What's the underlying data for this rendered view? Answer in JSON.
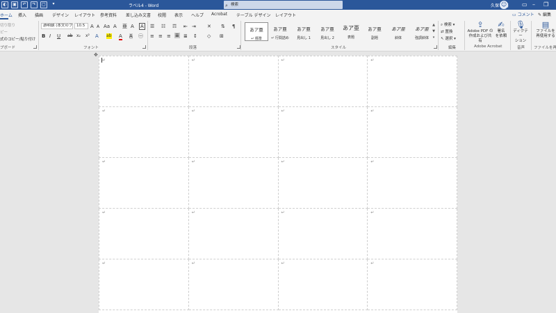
{
  "titlebar": {
    "doc_title": "ラベル4 - Word",
    "search_placeholder": "検索",
    "user_name": "久保 昌裕",
    "qat_icons": [
      "autosave-icon",
      "save-icon",
      "undo-icon",
      "redo-icon",
      "new-doc-icon",
      "customize-qat-icon"
    ]
  },
  "tabs": [
    {
      "label": "ホーム",
      "active": true
    },
    {
      "label": "挿入"
    },
    {
      "label": "描画"
    },
    {
      "label": "デザイン"
    },
    {
      "label": "レイアウト"
    },
    {
      "label": "参考資料"
    },
    {
      "label": "差し込み文書"
    },
    {
      "label": "校閲"
    },
    {
      "label": "表示"
    },
    {
      "label": "ヘルプ"
    },
    {
      "label": "Acrobat"
    },
    {
      "label": "テーブル デザイン"
    },
    {
      "label": "レイアウト"
    }
  ],
  "share_label": "コメント",
  "edit_label": "編集",
  "ribbon": {
    "clipboard": {
      "label": "プボード",
      "items": [
        "切り取り",
        "ピー",
        "式のコピー/貼り付け"
      ]
    },
    "font": {
      "label": "フォント",
      "font_name": "游明朝 (本文のフ",
      "font_size": "10.5",
      "grow": "A",
      "shrink": "A",
      "case": "Aa",
      "clear": "A",
      "phonetic": "亜",
      "enclose": "A",
      "bold": "B",
      "italic": "I",
      "underline": "U",
      "strike": "ab",
      "subscript": "x₂",
      "superscript": "x²",
      "effects": "A",
      "highlight": "ab",
      "color": "A",
      "shade": "A",
      "border_char": "A"
    },
    "paragraph": {
      "label": "段落"
    },
    "styles": {
      "label": "スタイル",
      "items": [
        {
          "preview": "あア亜",
          "name": "↵ 標準"
        },
        {
          "preview": "あア亜",
          "name": "↵ 行間詰め"
        },
        {
          "preview": "あア亜",
          "name": "見出し 1"
        },
        {
          "preview": "あア亜",
          "name": "見出し 2"
        },
        {
          "preview": "あア亜",
          "name": "表題"
        },
        {
          "preview": "あア亜",
          "name": "副題"
        },
        {
          "preview": "あア亜",
          "name": "斜体"
        },
        {
          "preview": "あア亜",
          "name": "強調斜体"
        }
      ]
    },
    "editing": {
      "label": "編集",
      "find": "検索",
      "replace": "置換",
      "select": "選択"
    },
    "acrobat": {
      "label": "Adobe Acrobat",
      "create_share": "Adobe PDF の\n作成および共有",
      "sign": "署名\nを依頼"
    },
    "voice": {
      "label": "音声",
      "dictate": "ディクテー\nション"
    },
    "reuse": {
      "label": "ファイルを再使",
      "reuse_files": "ファイルを\n再使用する"
    }
  },
  "document": {
    "rows": 5,
    "cols": 4,
    "para_mark": "↵",
    "move_handle": "✥"
  }
}
